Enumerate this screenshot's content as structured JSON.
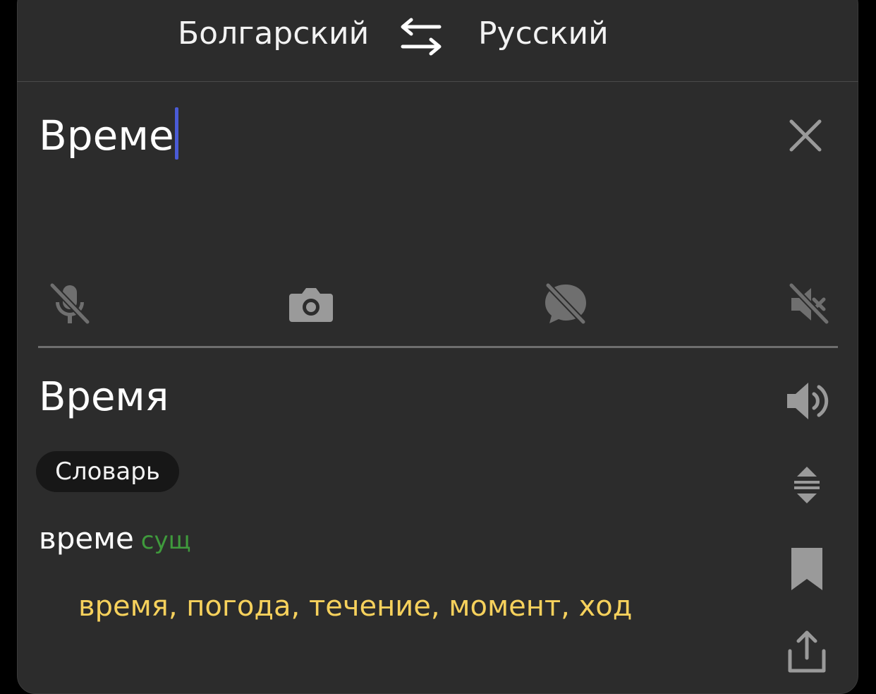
{
  "header": {
    "source_language": "Болгарский",
    "target_language": "Русский"
  },
  "input": {
    "value": "Време"
  },
  "toolbar": {
    "icons": [
      "microphone-off-icon",
      "camera-icon",
      "chat-off-icon",
      "sound-off-icon"
    ]
  },
  "result": {
    "translation": "Время",
    "dictionary_chip": "Словарь",
    "entry_word": "време",
    "entry_pos": "сущ",
    "meanings": "время, погода, течение, момент, ход"
  },
  "colors": {
    "background": "#2c2c2c",
    "caret": "#4a5bd6",
    "part_of_speech": "#3f9a3c",
    "meanings": "#f6d15c",
    "icon": "#8a8a8a"
  }
}
